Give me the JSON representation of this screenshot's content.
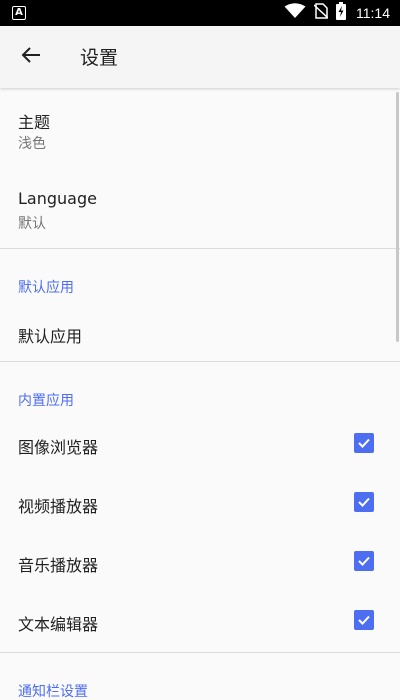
{
  "status_bar": {
    "time": "11:14",
    "app_icon_letter": "A",
    "icons": [
      "wifi-icon",
      "no-sim-icon",
      "battery-charging-icon"
    ]
  },
  "app_bar": {
    "back_icon": "arrow-back-icon",
    "title": "设置"
  },
  "settings": {
    "theme": {
      "label": "主题",
      "value": "浅色"
    },
    "language": {
      "label": "Language",
      "value": "默认"
    },
    "default_apps": {
      "header": "默认应用",
      "item_label": "默认应用"
    },
    "builtin_apps": {
      "header": "内置应用",
      "items": [
        {
          "label": "图像浏览器",
          "checked": true
        },
        {
          "label": "视频播放器",
          "checked": true
        },
        {
          "label": "音乐播放器",
          "checked": true
        },
        {
          "label": "文本编辑器",
          "checked": true
        }
      ]
    },
    "notification": {
      "header": "通知栏设置"
    }
  },
  "colors": {
    "accent": "#4e6ef2",
    "status_bar_bg": "#000000",
    "app_bar_bg": "#f5f5f5",
    "background": "#fafafa"
  }
}
